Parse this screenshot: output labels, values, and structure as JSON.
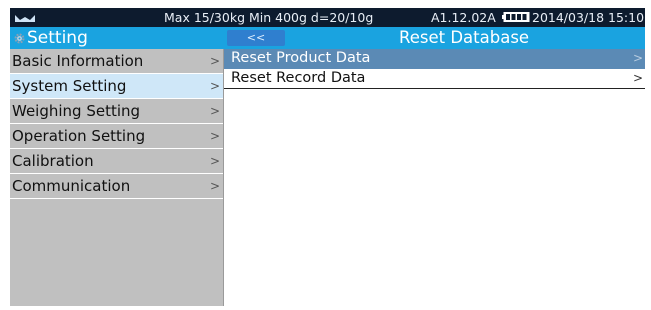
{
  "status_bar": {
    "logo_icon": "wave-logo-icon",
    "spec_text": "Max 15/30kg  Min 400g  d=20/10g",
    "version": "A1.12.02A",
    "battery_icon": "battery-full-icon",
    "datetime": "2014/03/18  15:10"
  },
  "sidebar": {
    "header_icon": "gear-icon",
    "title": "Setting",
    "chevron": ">",
    "items": [
      {
        "label": "Basic Information"
      },
      {
        "label": "System Setting",
        "selected": true
      },
      {
        "label": "Weighing Setting"
      },
      {
        "label": "Operation Setting"
      },
      {
        "label": "Calibration"
      },
      {
        "label": "Communication"
      }
    ]
  },
  "main": {
    "back_label": "<<",
    "title": "Reset Database",
    "chevron": ">",
    "items": [
      {
        "label": "Reset Product Data",
        "highlighted": true
      },
      {
        "label": "Reset Record Data"
      }
    ]
  },
  "colors": {
    "status_bar_bg": "#0d1b2e",
    "header_bg": "#1aa3e0",
    "back_button_bg": "#2f7fcf",
    "sidebar_bg": "#c0c0c0",
    "sidebar_selected_bg": "#cfe7f8",
    "list_highlight_bg": "#5b8ab5"
  }
}
